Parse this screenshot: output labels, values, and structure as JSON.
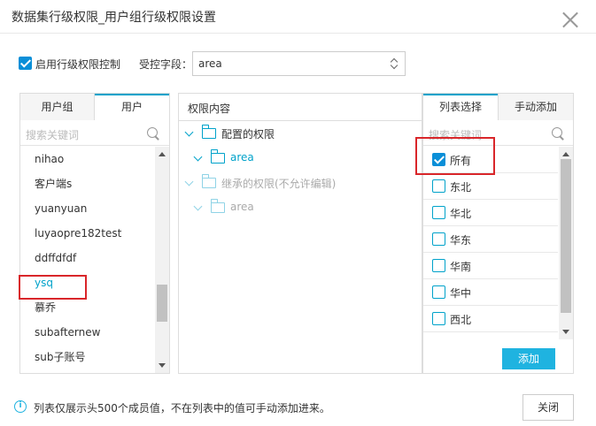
{
  "dialog": {
    "title": "数据集行级权限_用户组行级权限设置",
    "close_button": "关闭"
  },
  "controls": {
    "enable_label": "启用行级权限控制",
    "enable_checked": true,
    "field_label": "受控字段：",
    "field_value": "area"
  },
  "left_panel": {
    "tabs": [
      "用户组",
      "用户"
    ],
    "active_tab": "用户",
    "search_placeholder": "搜索关键词",
    "users": [
      "nihao",
      "客户端s",
      "yuanyuan",
      "luyaopre182test",
      "ddffdfdf",
      "ysq",
      "慕乔",
      "subafternew",
      "sub子账号"
    ],
    "selected_user": "ysq"
  },
  "middle_panel": {
    "header": "权限内容",
    "tree": [
      {
        "label": "配置的权限",
        "level": 0,
        "dim": false
      },
      {
        "label": "area",
        "level": 1,
        "dim": false
      },
      {
        "label": "继承的权限(不允许编辑)",
        "level": 0,
        "dim": true
      },
      {
        "label": "area",
        "level": 1,
        "dim": true
      }
    ]
  },
  "right_panel": {
    "tabs": [
      "列表选择",
      "手动添加"
    ],
    "active_tab": "列表选择",
    "search_placeholder": "搜索关键词",
    "options": [
      {
        "label": "所有",
        "checked": true
      },
      {
        "label": "东北",
        "checked": false
      },
      {
        "label": "华北",
        "checked": false
      },
      {
        "label": "华东",
        "checked": false
      },
      {
        "label": "华南",
        "checked": false
      },
      {
        "label": "华中",
        "checked": false
      },
      {
        "label": "西北",
        "checked": false
      }
    ],
    "add_button": "添加"
  },
  "footer": {
    "info": "列表仅展示头500个成员值，不在列表中的值可手动添加进来。"
  },
  "colors": {
    "accent": "#00a2ca",
    "button": "#1fb3e0",
    "highlight_border": "#d9262a"
  },
  "icons": {
    "close": "close-icon",
    "search": "search-icon",
    "folder": "folder-icon",
    "expand": "chevron-down-icon",
    "info": "info-icon"
  }
}
